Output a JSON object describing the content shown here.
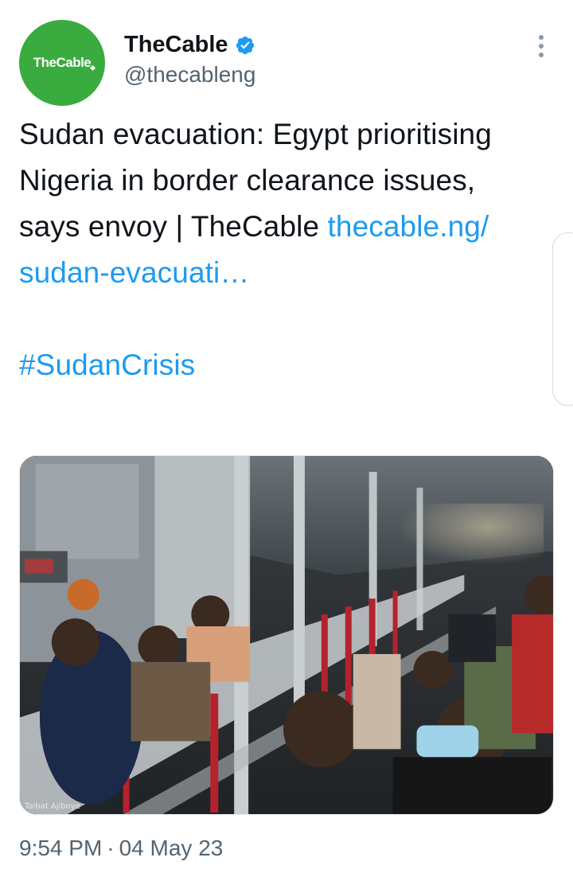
{
  "author": {
    "avatar_text": "TheCable",
    "display_name": "TheCable",
    "handle": "@thecableng",
    "verified": true
  },
  "tweet": {
    "text_plain": "Sudan evacuation: Egypt prioritising Nigeria in border clearance issues, says envoy | TheCable",
    "link_text": "thecable.ng/ sudan-evacuati…",
    "hashtag": "#SudanCrisis"
  },
  "media": {
    "photo_credit": "Taibat Ajiboye"
  },
  "meta": {
    "time": "9:54 PM",
    "separator": "·",
    "date": "04 May 23"
  },
  "colors": {
    "link": "#1d9bf0",
    "avatar_bg": "#3aab3f",
    "verified": "#1d9bf0",
    "secondary_text": "#536471"
  },
  "icons": {
    "verified": "verified-badge-icon",
    "more": "more-options-icon"
  }
}
